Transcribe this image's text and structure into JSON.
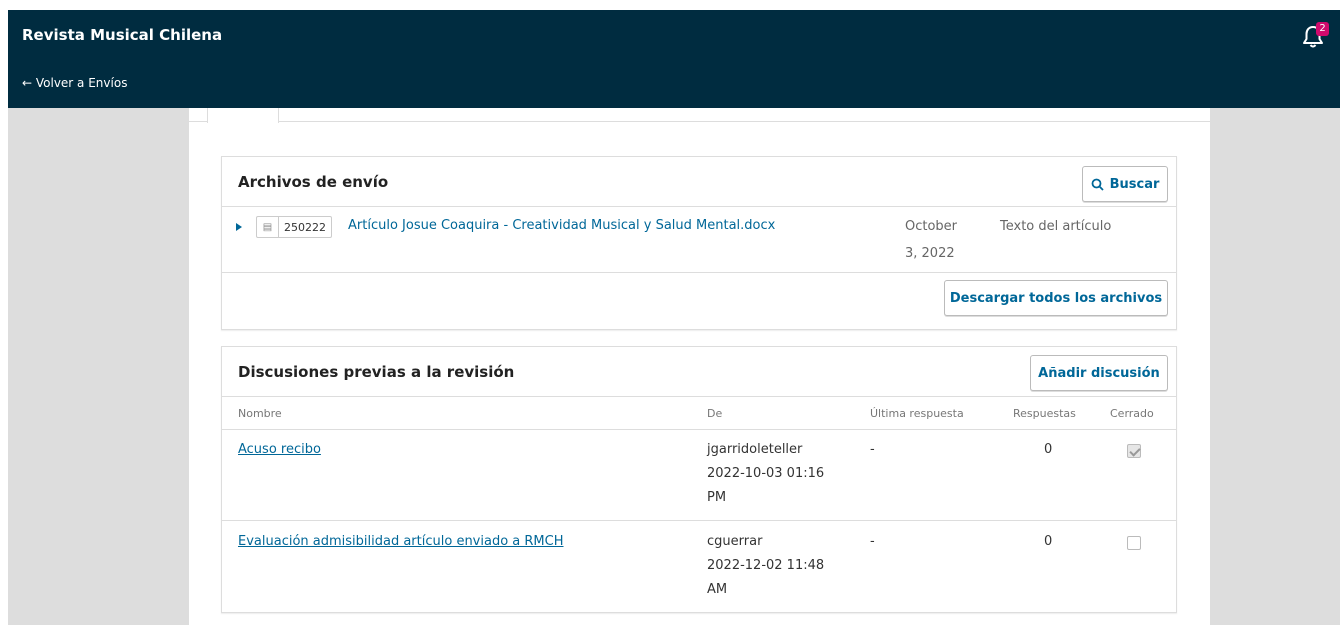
{
  "colors": {
    "header_bg": "#002c40",
    "link": "#006798",
    "badge": "#d00a6c"
  },
  "header": {
    "title": "Revista Musical Chilena",
    "back_link": "← Volver a Envíos",
    "notifications": {
      "icon": "bell-icon",
      "count": "2"
    }
  },
  "files_panel": {
    "title": "Archivos de envío",
    "search_button": "Buscar",
    "search_icon": "search-icon",
    "files": [
      {
        "id": "250222",
        "name": "Artículo Josue Coaquira - Creatividad Musical y Salud Mental.docx",
        "date_line1": "October",
        "date_line2": "3, 2022",
        "type": "Texto del artículo"
      }
    ],
    "download_all_button": "Descargar todos los archivos"
  },
  "discussions_panel": {
    "title": "Discusiones previas a la revisión",
    "add_button": "Añadir discusión",
    "columns": [
      "Nombre",
      "De",
      "Última respuesta",
      "Respuestas",
      "Cerrado"
    ],
    "rows": [
      {
        "name": "Acuso recibo",
        "from_user": "jgarridoleteller",
        "from_date1": "2022-10-03 01:16",
        "from_date2": "PM",
        "last_reply": "-",
        "replies": "0",
        "closed": true
      },
      {
        "name": "Evaluación admisibilidad artículo enviado a RMCH",
        "from_user": "cguerrar",
        "from_date1": "2022-12-02 11:48",
        "from_date2": "AM",
        "last_reply": "-",
        "replies": "0",
        "closed": false
      }
    ]
  }
}
